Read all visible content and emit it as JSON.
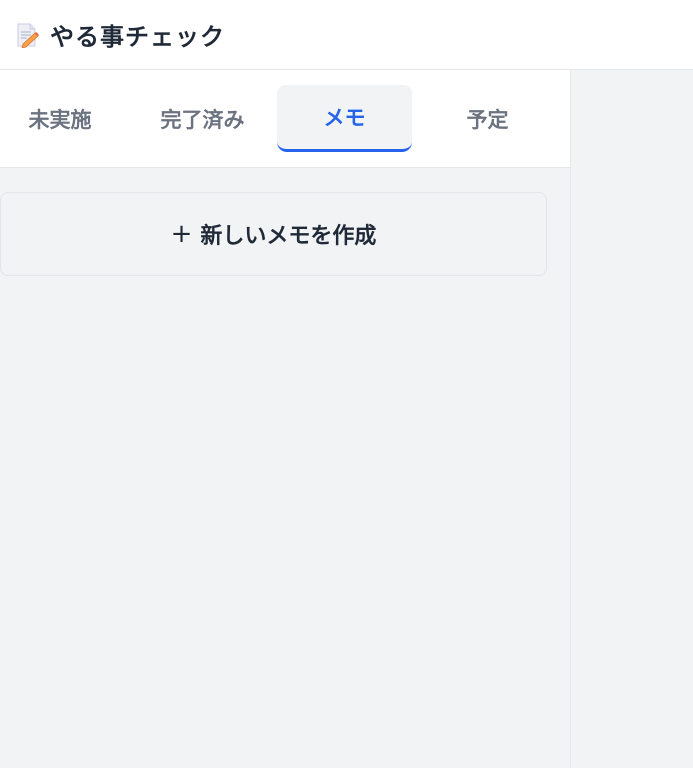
{
  "header": {
    "title": "やる事チェック",
    "icon": "memo-pencil-icon"
  },
  "tabs": [
    {
      "label": "未実施",
      "active": false
    },
    {
      "label": "完了済み",
      "active": false
    },
    {
      "label": "メモ",
      "active": true
    },
    {
      "label": "予定",
      "active": false
    }
  ],
  "main": {
    "new_memo_plus": "+",
    "new_memo_label": "新しいメモを作成"
  },
  "colors": {
    "accent": "#2563eb",
    "text_dark": "#1f2937",
    "text_muted": "#6b7280",
    "panel_bg": "#f2f3f5"
  }
}
